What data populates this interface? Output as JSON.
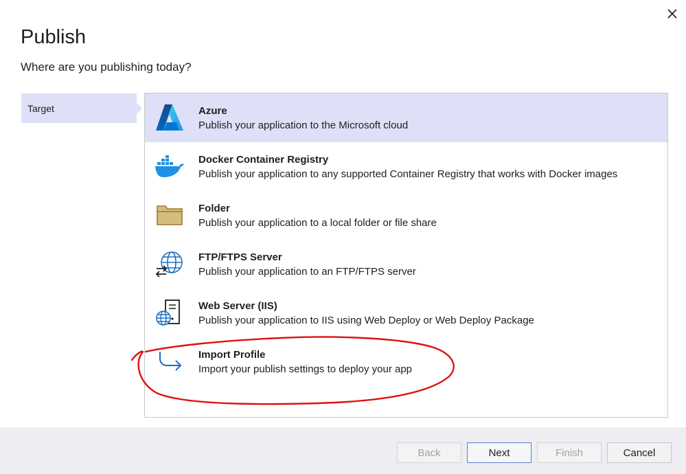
{
  "dialog": {
    "title": "Publish",
    "subtitle": "Where are you publishing today?"
  },
  "nav": {
    "items": [
      {
        "label": "Target",
        "selected": true
      }
    ]
  },
  "targets": [
    {
      "name": "Azure",
      "description": "Publish your application to the Microsoft cloud",
      "icon": "azure-logo-icon",
      "selected": true
    },
    {
      "name": "Docker Container Registry",
      "description": "Publish your application to any supported Container Registry that works with Docker images",
      "icon": "docker-whale-icon",
      "selected": false
    },
    {
      "name": "Folder",
      "description": "Publish your application to a local folder or file share",
      "icon": "folder-icon",
      "selected": false
    },
    {
      "name": "FTP/FTPS Server",
      "description": "Publish your application to an FTP/FTPS server",
      "icon": "globe-transfer-icon",
      "selected": false
    },
    {
      "name": "Web Server (IIS)",
      "description": "Publish your application to IIS using Web Deploy or Web Deploy Package",
      "icon": "server-globe-icon",
      "selected": false
    },
    {
      "name": "Import Profile",
      "description": "Import your publish settings to deploy your app",
      "icon": "import-arrow-icon",
      "selected": false
    }
  ],
  "buttons": {
    "back": "Back",
    "next": "Next",
    "finish": "Finish",
    "cancel": "Cancel"
  },
  "colors": {
    "selection": "#dde0f6",
    "annotation": "#e01010",
    "accent": "#0e5db5"
  }
}
